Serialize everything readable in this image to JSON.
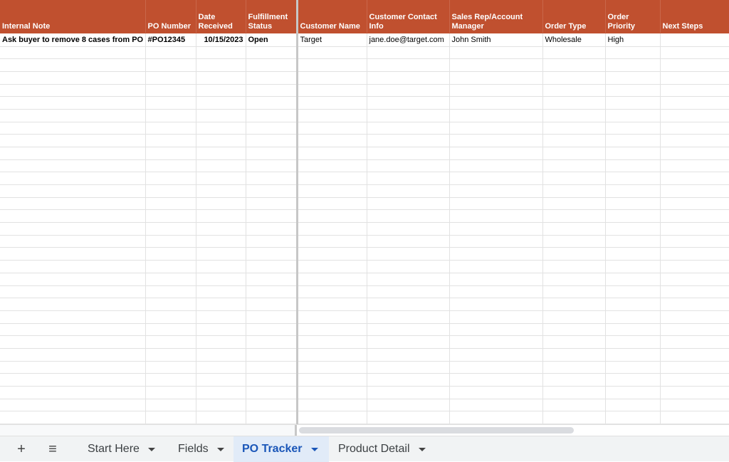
{
  "sheet": {
    "headers": [
      "Internal Note",
      "PO Number",
      "Date Received",
      "Fulfillment Status",
      "Customer Name",
      "Customer Contact Info",
      "Sales Rep/Account Manager",
      "Order Type",
      "Order Priority",
      "Next Steps"
    ],
    "rows": [
      [
        "Ask buyer to remove 8 cases from PO",
        "#PO12345",
        "10/15/2023",
        "Open",
        "Target",
        "jane.doe@target.com",
        "John Smith",
        "Wholesale",
        "High",
        ""
      ]
    ]
  },
  "sheetbar": {
    "add_icon": "+",
    "menu_icon": "≡",
    "tabs": [
      {
        "label": "Start Here",
        "active": false
      },
      {
        "label": "Fields",
        "active": false
      },
      {
        "label": "PO Tracker",
        "active": true
      },
      {
        "label": "Product Detail",
        "active": false
      }
    ]
  },
  "icons": {
    "add": "plus-icon",
    "menu": "hamburger-icon",
    "tab_dropdown": "chevron-down-icon"
  },
  "colors": {
    "header_bg": "#c0502f",
    "header_text": "#ffffff",
    "active_tab_bg": "#e1ebf8",
    "active_tab_text": "#1a56b8"
  }
}
